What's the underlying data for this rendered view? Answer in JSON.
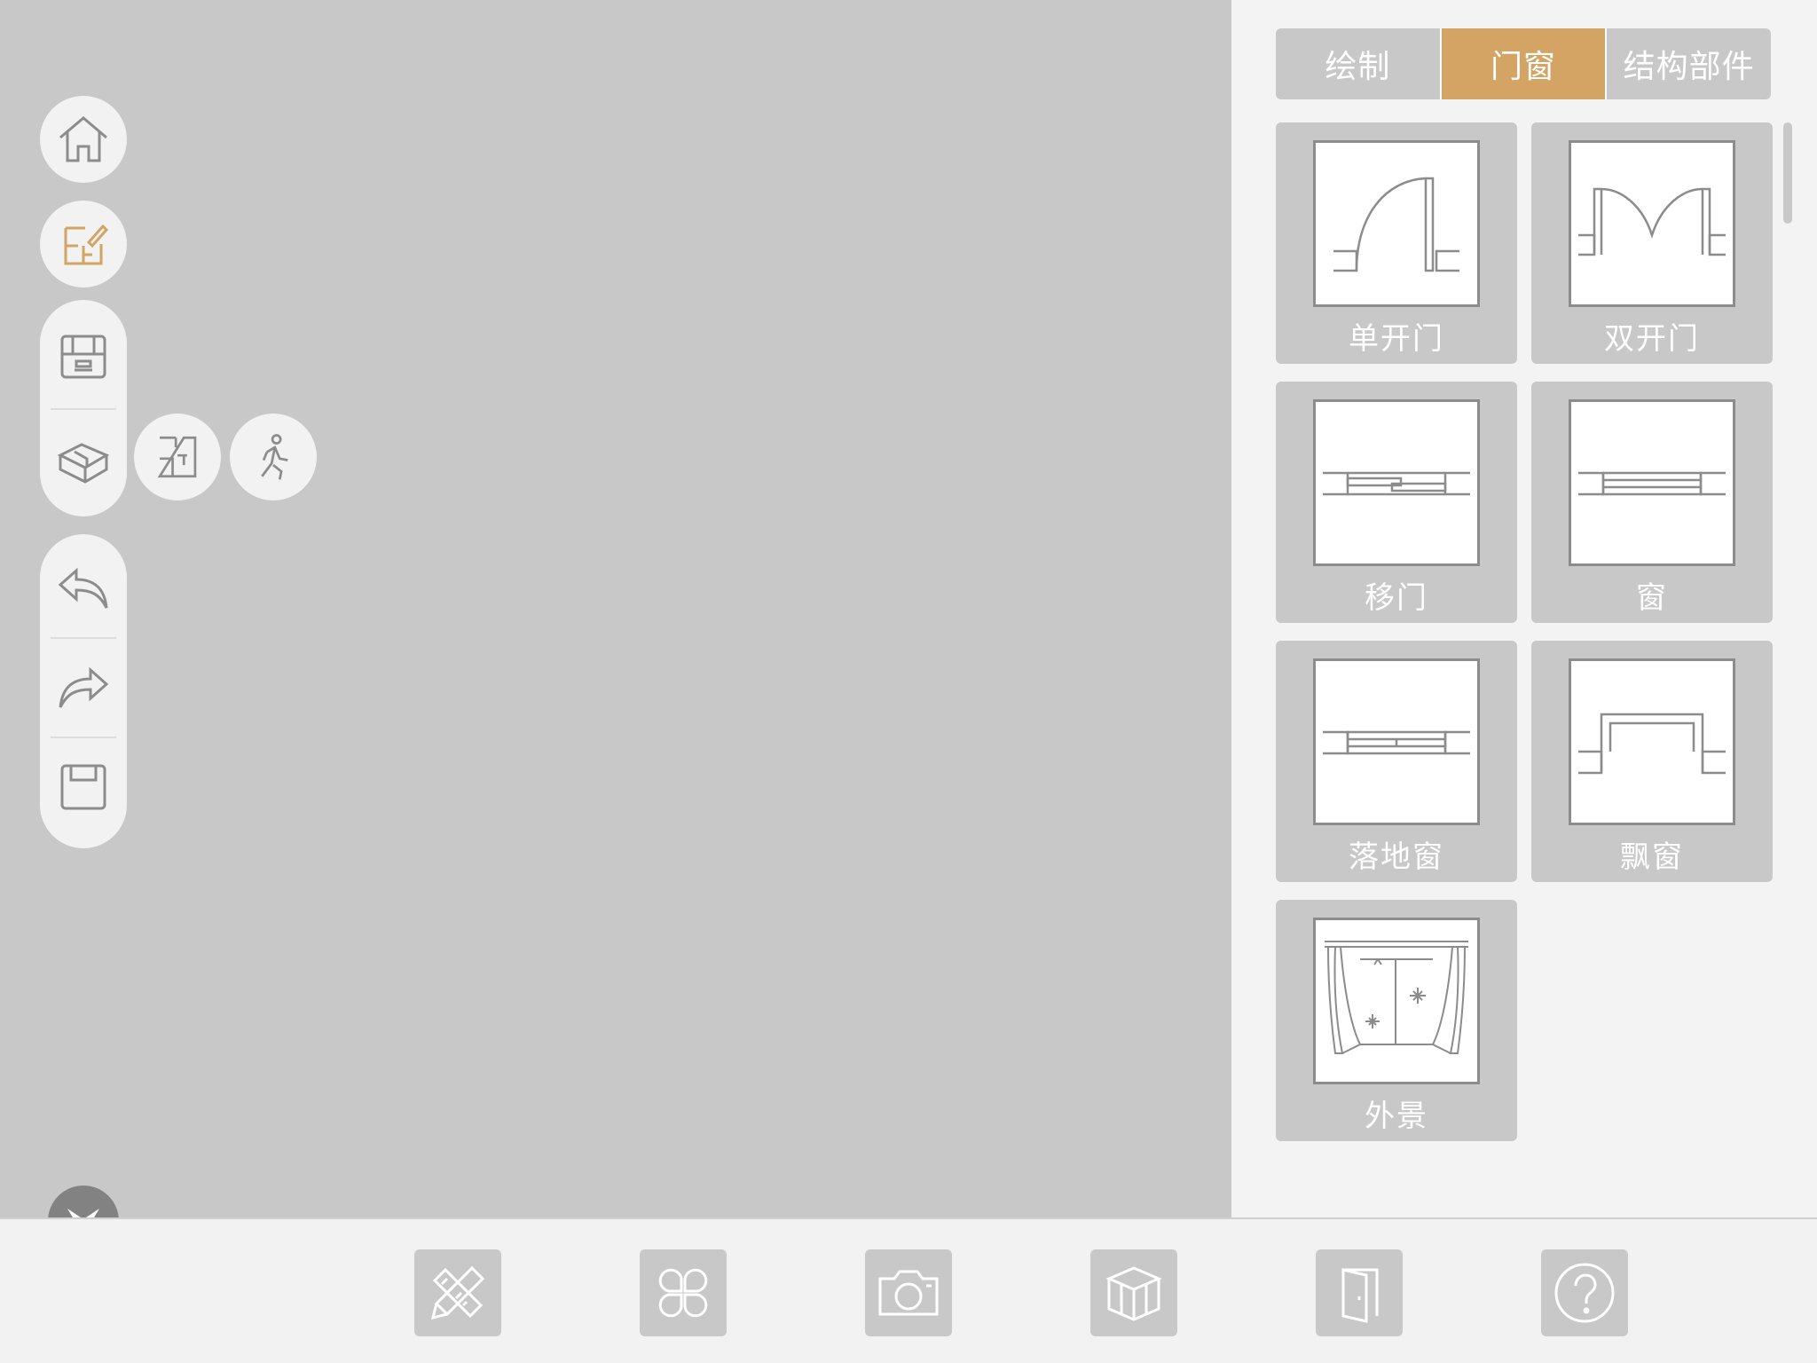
{
  "tabs": [
    {
      "label": "绘制",
      "active": false
    },
    {
      "label": "门窗",
      "active": true
    },
    {
      "label": "结构部件",
      "active": false
    }
  ],
  "items": [
    {
      "label": "单开门",
      "icon": "single-door-icon"
    },
    {
      "label": "双开门",
      "icon": "double-door-icon"
    },
    {
      "label": "移门",
      "icon": "sliding-door-icon"
    },
    {
      "label": "窗",
      "icon": "window-icon"
    },
    {
      "label": "落地窗",
      "icon": "french-window-icon"
    },
    {
      "label": "飘窗",
      "icon": "bay-window-icon"
    },
    {
      "label": "外景",
      "icon": "outdoor-scene-icon"
    }
  ],
  "left_toolbar": [
    "home-icon",
    "floorplan-edit-icon",
    "2d-view-icon",
    "3d-view-icon",
    "floor-plan-icon",
    "walk-mode-icon",
    "undo-icon",
    "redo-icon",
    "save-icon"
  ],
  "bottom_toolbar": [
    "ruler-pencil-icon",
    "catalog-icon",
    "camera-icon",
    "cube-icon",
    "door-icon",
    "help-icon"
  ],
  "colors": {
    "accent": "#d3a464",
    "panel": "#f3f3f3",
    "canvas": "#c8c8c8",
    "icon": "#8c8c8c"
  }
}
